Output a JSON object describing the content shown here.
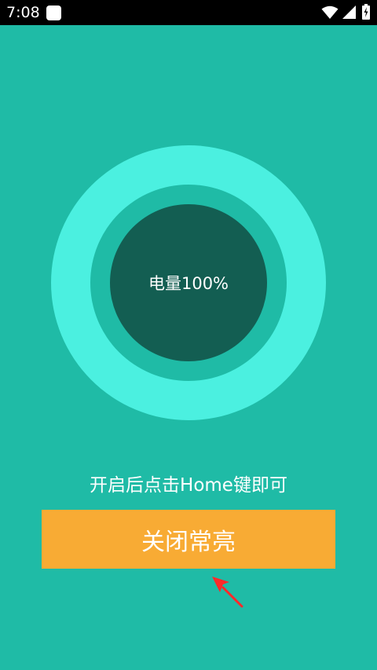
{
  "status_bar": {
    "time": "7:08",
    "notification_icon": "app-notification-icon",
    "wifi_icon": "wifi-icon",
    "signal_icon": "cell-signal-icon",
    "battery_icon": "battery-charging-icon"
  },
  "battery": {
    "label": "电量100%"
  },
  "hint": {
    "text": "开启后点击Home键即可"
  },
  "toggle_button": {
    "label": "关闭常亮"
  },
  "annotation": {
    "icon": "red-arrow-icon"
  },
  "colors": {
    "background": "#1fbba6",
    "ring_outer": "#4bf0e0",
    "ring_inner": "#135e52",
    "button": "#f8ab34",
    "arrow": "#ff2a2a"
  }
}
